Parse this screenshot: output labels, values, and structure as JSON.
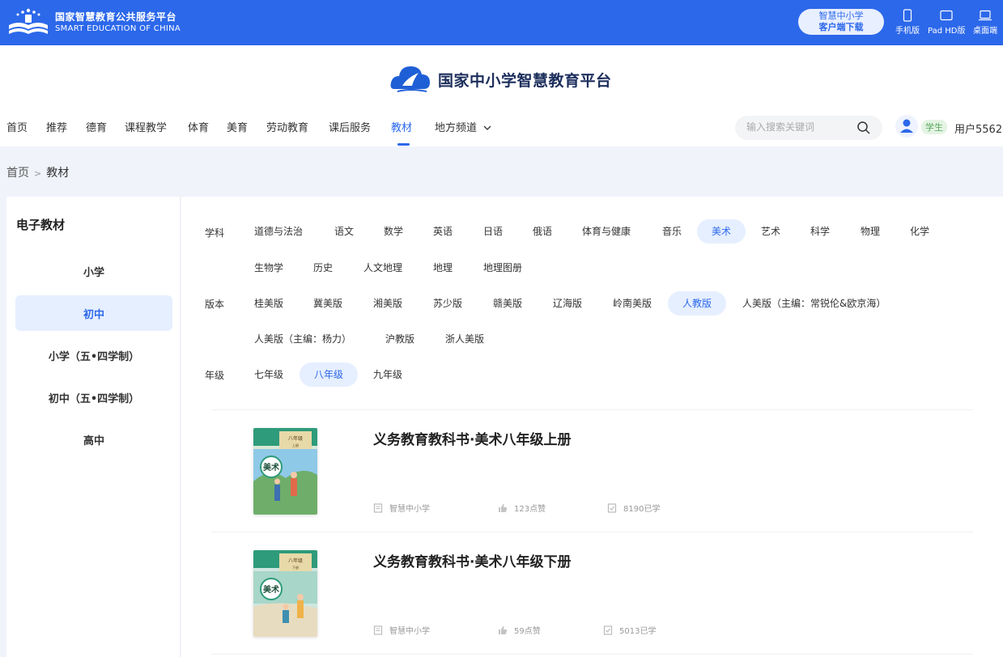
{
  "topbar": {
    "brand_cn": "国家智慧教育公共服务平台",
    "brand_en": "SMART EDUCATION OF CHINA",
    "download_line1": "智慧中小学",
    "download_line2": "客户端下载",
    "devices": [
      "手机版",
      "Pad HD版",
      "桌面端"
    ]
  },
  "header": {
    "site_title": "国家中小学智慧教育平台",
    "nav": [
      "首页",
      "推荐",
      "德育",
      "课程教学",
      "体育",
      "美育",
      "劳动教育",
      "课后服务",
      "教材",
      "地方频道"
    ],
    "active_nav": "教材",
    "search_placeholder": "输入搜索关键词",
    "role": "学生",
    "username": "用户5562"
  },
  "breadcrumb": {
    "home": "首页",
    "sep": ">",
    "current": "教材"
  },
  "sidebar": {
    "title": "电子教材",
    "items": [
      "小学",
      "初中",
      "小学（五•四学制）",
      "初中（五•四学制）",
      "高中"
    ],
    "active": "初中"
  },
  "filters": {
    "subject_label": "学科",
    "subjects": [
      "道德与法治",
      "语文",
      "数学",
      "英语",
      "日语",
      "俄语",
      "体育与健康",
      "音乐",
      "美术",
      "艺术",
      "科学",
      "物理",
      "化学",
      "生物学",
      "历史",
      "人文地理",
      "地理",
      "地理图册"
    ],
    "subject_active": "美术",
    "edition_label": "版本",
    "editions": [
      "桂美版",
      "冀美版",
      "湘美版",
      "苏少版",
      "赣美版",
      "辽海版",
      "岭南美版",
      "人教版",
      "人美版（主编：常锐伦&欧京海）",
      "人美版（主编：杨力）",
      "沪教版",
      "浙人美版"
    ],
    "edition_active": "人教版",
    "grade_label": "年级",
    "grades": [
      "七年级",
      "八年级",
      "九年级"
    ],
    "grade_active": "八年级"
  },
  "books": [
    {
      "title": "义务教育教科书·美术八年级上册",
      "cover_text": "美术",
      "cover_grade": "八年级",
      "cover_term": "上册",
      "publisher": "智慧中小学",
      "likes": "123点赞",
      "learned": "8190已学"
    },
    {
      "title": "义务教育教科书·美术八年级下册",
      "cover_text": "美术",
      "cover_grade": "八年级",
      "cover_term": "下册",
      "publisher": "智慧中小学",
      "likes": "59点赞",
      "learned": "5013已学"
    }
  ],
  "colors": {
    "brand_blue": "#2c68ea",
    "chip_bg": "#e6efff",
    "page_bg": "#f0f3fa"
  }
}
